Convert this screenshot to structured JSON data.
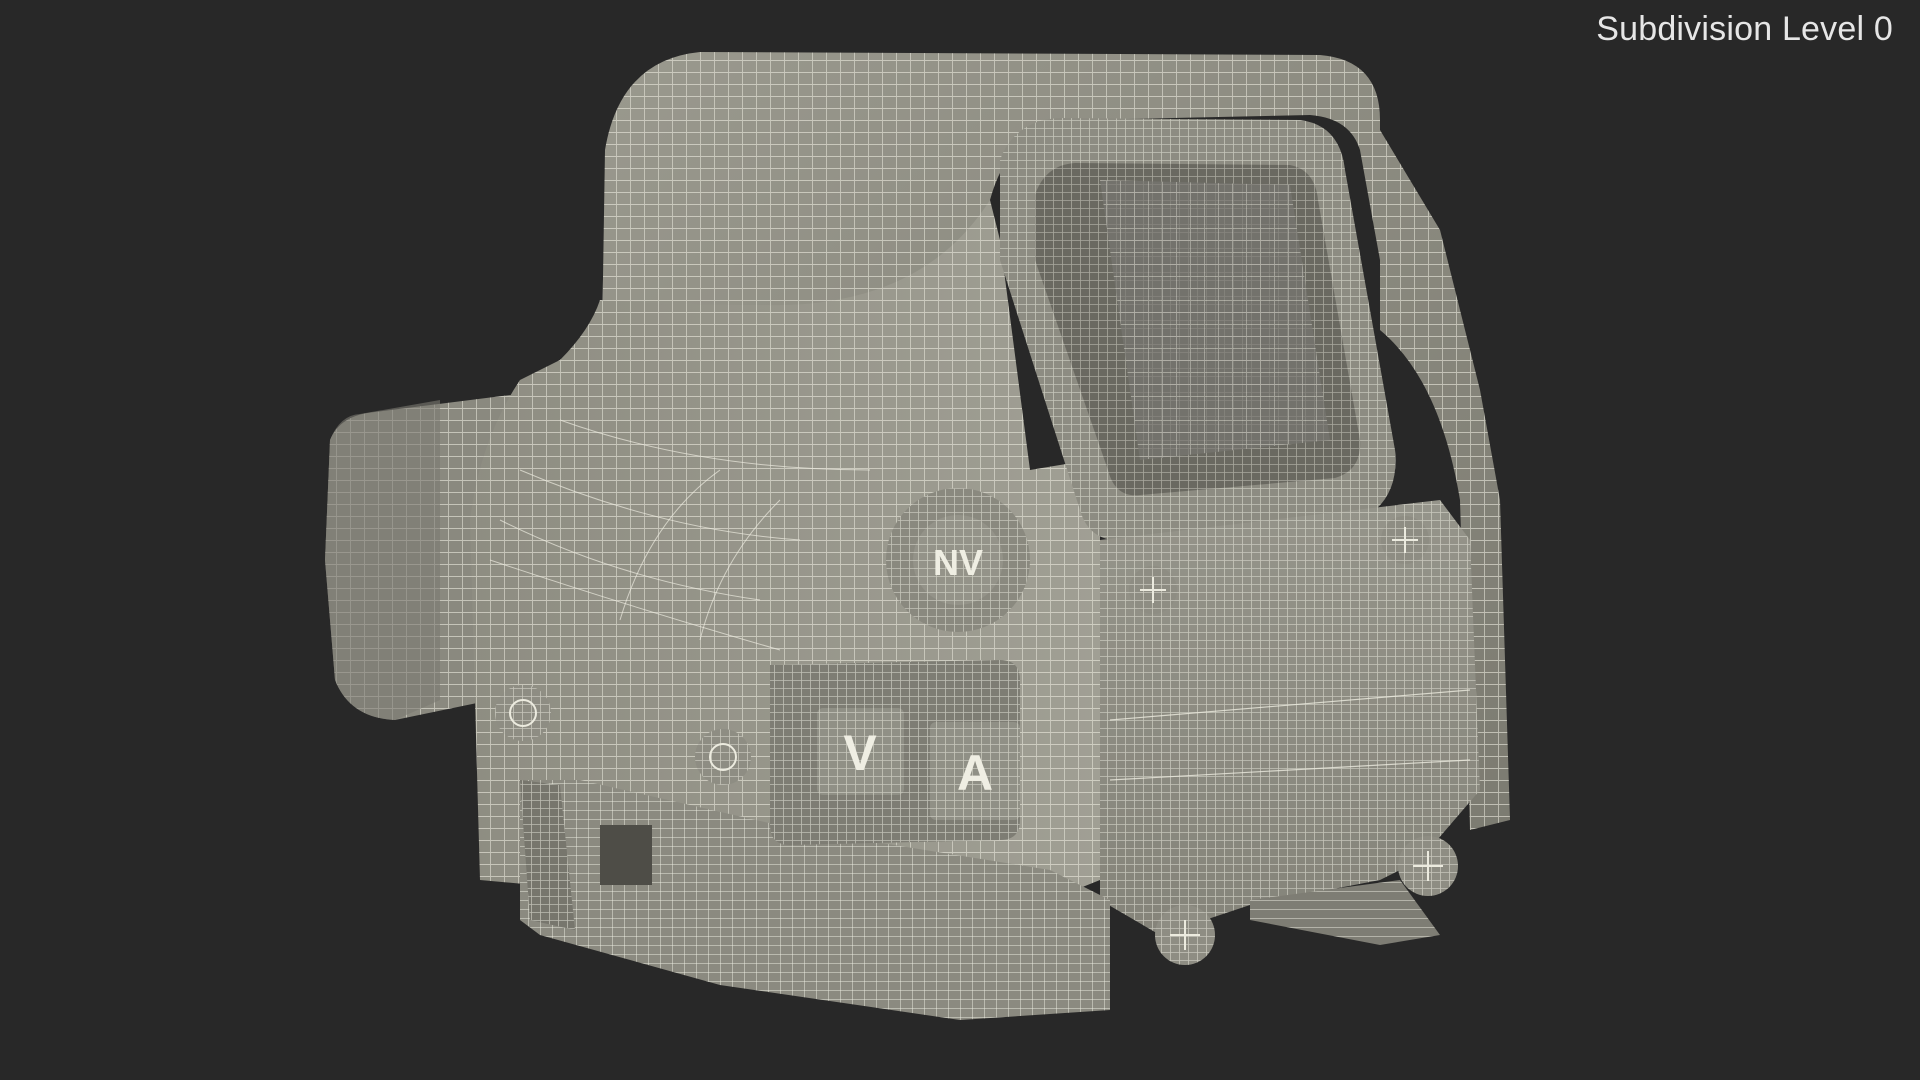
{
  "viewport": {
    "label": "Subdivision Level 0"
  },
  "scene": {
    "object": "holographic-sight-wireframe",
    "colors": {
      "background": "#282828",
      "surface": "#8c8b80",
      "surface_light": "#a2a196",
      "surface_dark": "#5f5e56",
      "wire": "#ecebdf"
    },
    "button_glyphs": [
      "NV",
      "V",
      "A"
    ]
  }
}
